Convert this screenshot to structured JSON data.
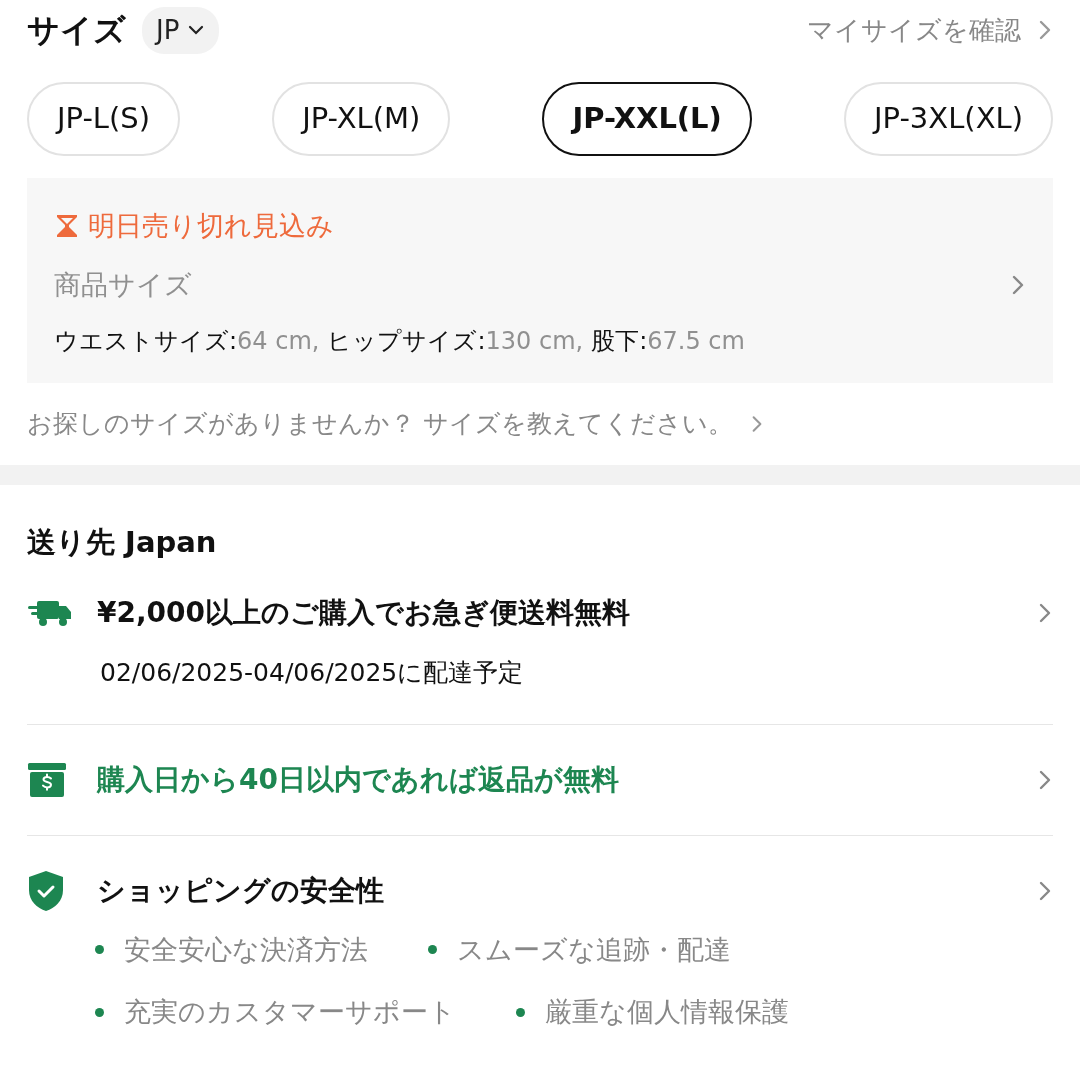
{
  "size_header": {
    "title": "サイズ",
    "region": "JP",
    "my_size_link": "マイサイズを確認"
  },
  "sizes": [
    {
      "label": "JP-L(S)",
      "selected": false
    },
    {
      "label": "JP-XL(M)",
      "selected": false
    },
    {
      "label": "JP-XXL(L)",
      "selected": true
    },
    {
      "label": "JP-3XL(XL)",
      "selected": false
    }
  ],
  "size_info": {
    "stock_warning": "明日売り切れ見込み",
    "product_size_label": "商品サイズ",
    "measurements": [
      {
        "label": "ウエストサイズ:",
        "value": "64 cm,"
      },
      {
        "label": "ヒップサイズ:",
        "value": "130 cm,"
      },
      {
        "label": "股下:",
        "value": "67.5 cm"
      }
    ]
  },
  "size_help": "お探しのサイズがありませんか？ サイズを教えてください。",
  "shipping": {
    "title": "送り先 Japan",
    "rows": [
      {
        "kind": "truck",
        "text": "¥2,000以上のご購入でお急ぎ便送料無料",
        "subtext": "02/06/2025-04/06/2025に配達予定",
        "accent": false
      },
      {
        "kind": "return",
        "text": "購入日から40日以内であれば返品が無料",
        "accent": true
      },
      {
        "kind": "shield",
        "text": "ショッピングの安全性",
        "accent": false,
        "bullets": [
          [
            "安全安心な決済方法",
            "スムーズな追跡・配達"
          ],
          [
            "充実のカスタマーサポート",
            "厳重な個人情報保護"
          ]
        ]
      }
    ]
  }
}
